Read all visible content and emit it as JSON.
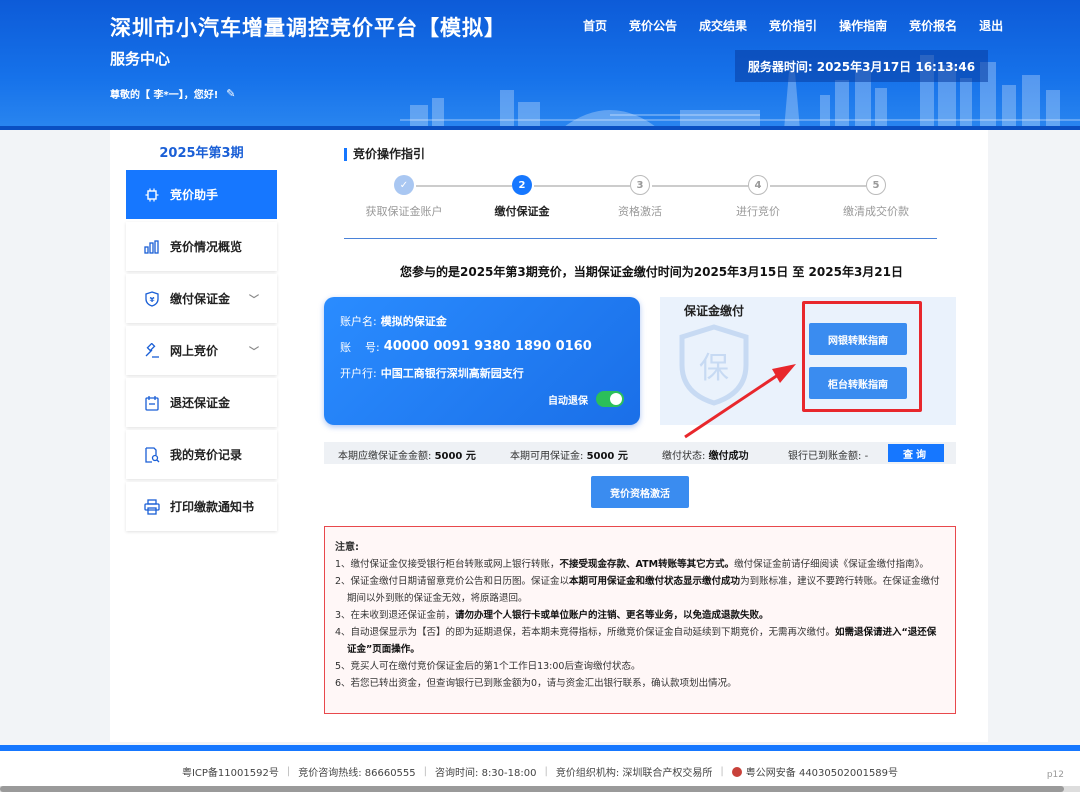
{
  "header": {
    "title": "深圳市小汽车增量调控竞价平台【模拟】",
    "subtitle": "服务中心",
    "greeting": "尊敬的【 李*一】，您好!",
    "nav": [
      "首页",
      "竞价公告",
      "成交结果",
      "竞价指引",
      "操作指南",
      "竞价报名",
      "退出"
    ],
    "server_time_label": "服务器时间:",
    "server_time_value": "2025年3月17日 16:13:46"
  },
  "sidebar": {
    "period": "2025年第3期",
    "items": [
      {
        "label": "竞价助手",
        "icon": "cpu-icon",
        "active": true
      },
      {
        "label": "竞价情况概览",
        "icon": "bar-chart-icon"
      },
      {
        "label": "缴付保证金",
        "icon": "shield-icon",
        "expandable": true
      },
      {
        "label": "网上竞价",
        "icon": "gavel-icon",
        "expandable": true
      },
      {
        "label": "退还保证金",
        "icon": "calendar-icon"
      },
      {
        "label": "我的竞价记录",
        "icon": "document-search-icon"
      },
      {
        "label": "打印缴款通知书",
        "icon": "printer-icon"
      }
    ]
  },
  "guide": {
    "title": "竞价操作指引",
    "steps": [
      {
        "num": "✓",
        "label": "获取保证金账户",
        "state": "done"
      },
      {
        "num": "2",
        "label": "缴付保证金",
        "state": "current"
      },
      {
        "num": "3",
        "label": "资格激活",
        "state": "todo"
      },
      {
        "num": "4",
        "label": "进行竞价",
        "state": "todo"
      },
      {
        "num": "5",
        "label": "缴清成交价款",
        "state": "todo"
      }
    ]
  },
  "notice_line": "您参与的是2025年第3期竞价，当期保证金缴付时间为2025年3月15日 至 2025年3月21日",
  "account": {
    "name_label": "账户名:",
    "name_value": "模拟的保证金",
    "number_label": "账    号:",
    "number_value": "40000 0091 9380 1890 0160",
    "bank_label": "开户行:",
    "bank_value": "中国工商银行深圳高新园支行",
    "auto_refund_label": "自动退保",
    "auto_refund_on": true
  },
  "payment": {
    "title": "保证金缴付",
    "shield_char": "保",
    "online_button": "网银转账指南",
    "counter_button": "柜台转账指南"
  },
  "status": {
    "due_label": "本期应缴保证金金额:",
    "due_value": "5000 元",
    "available_label": "本期可用保证金:",
    "available_value": "5000 元",
    "state_label": "缴付状态:",
    "state_value": "缴付成功",
    "arrived_label": "银行已到账金额:",
    "arrived_value": "-",
    "query_button": "查询"
  },
  "activate_button": "竞价资格激活",
  "notes": {
    "title": "注意:",
    "items": [
      [
        "1、缴付保证金仅接受银行柜台转账或网上银行转账，",
        "不接受现金存款、ATM转账等其它方式。",
        "缴付保证金前请仔细阅读《保证金缴付指南》。"
      ],
      [
        "2、保证金缴付日期请留意竞价公告和日历图。保证金以",
        "本期可用保证金和缴付状态显示缴付成功",
        "为到账标准，建议不要跨行转账。在保证金缴付期间以外到账的保证金无效，将原路退回。"
      ],
      [
        "3、在未收到退还保证金前，",
        "请勿办理个人银行卡或单位账户的注销、更名等业务，以免造成退款失败。",
        ""
      ],
      [
        "4、自动退保显示为【否】的即为延期退保，若本期未竞得指标，所缴竞价保证金自动延续到下期竞价，无需再次缴付。",
        "如需退保请进入“退还保证金”页面操作。",
        ""
      ],
      [
        "5、竞买人可在缴付竞价保证金后的第1个工作日13:00后查询缴付状态。",
        "",
        ""
      ],
      [
        "6、若您已转出资金，但查询银行已到账金额为0，请与资金汇出银行联系，确认款项划出情况。",
        "",
        ""
      ]
    ]
  },
  "footer": {
    "icp": "粤ICP备11001592号",
    "hotline": "竞价咨询热线: 86660555",
    "hours": "咨询时间: 8:30-18:00",
    "org": "竞价组织机构: 深圳联合产权交易所",
    "police": "粤公网安备 44030502001589号",
    "page": "p12"
  },
  "colors": {
    "primary": "#1677ff",
    "header": "#1672ea",
    "alert": "#e8272c",
    "success": "#2bbf5a"
  }
}
